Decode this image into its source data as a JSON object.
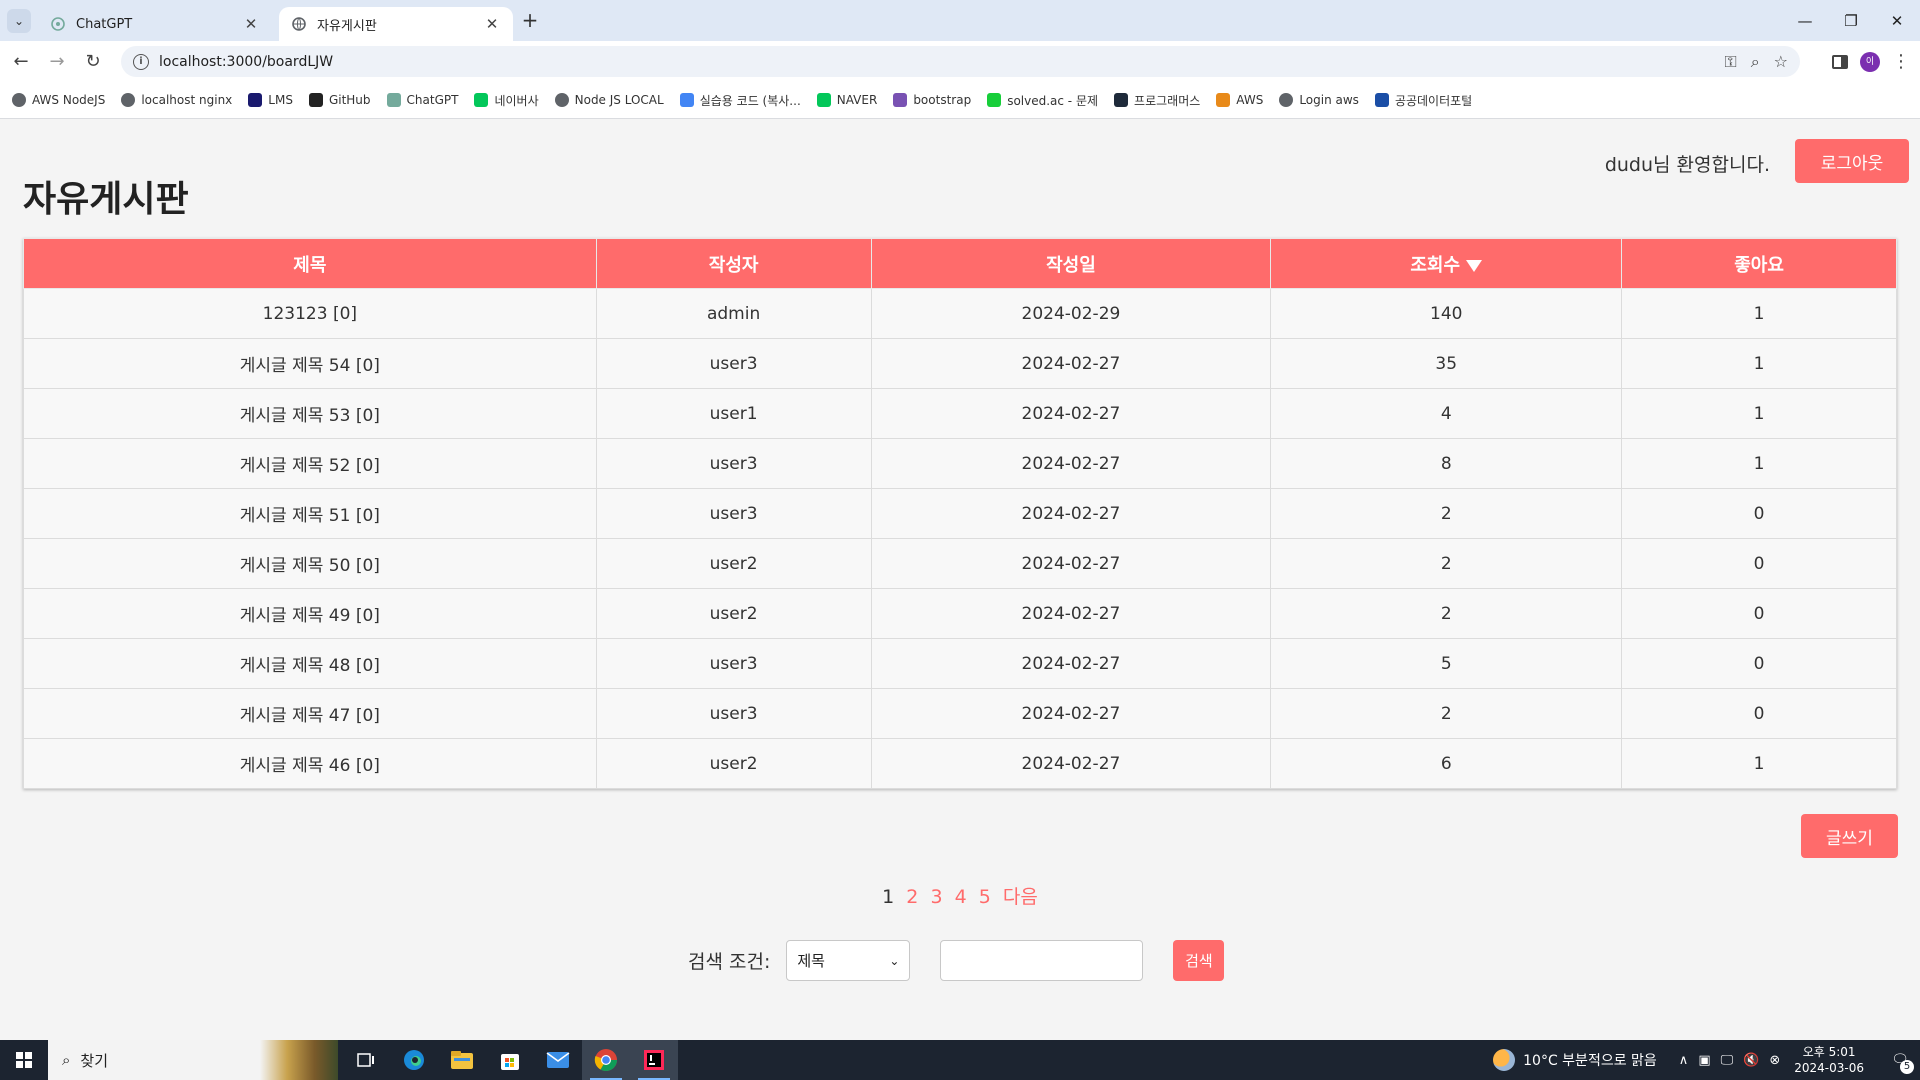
{
  "browser": {
    "tabs": [
      {
        "title": "ChatGPT",
        "icon": "chatgpt-icon"
      },
      {
        "title": "자유게시판",
        "icon": "globe-icon"
      }
    ],
    "url": "localhost:3000/boardLJW",
    "bookmarks": [
      {
        "label": "AWS NodeJS",
        "icon": "globe-icon",
        "color": "#5f6368"
      },
      {
        "label": "localhost nginx",
        "icon": "globe-icon",
        "color": "#5f6368"
      },
      {
        "label": "LMS",
        "icon": "lms-icon",
        "color": "#1a1a6e"
      },
      {
        "label": "GitHub",
        "icon": "github-icon",
        "color": "#222222"
      },
      {
        "label": "ChatGPT",
        "icon": "chatgpt-icon",
        "color": "#74aa9c"
      },
      {
        "label": "네이버사",
        "icon": "naver-icon",
        "color": "#03c75a"
      },
      {
        "label": "Node JS LOCAL",
        "icon": "globe-icon",
        "color": "#5f6368"
      },
      {
        "label": "실습용 코드 (복사...",
        "icon": "docs-icon",
        "color": "#4285f4"
      },
      {
        "label": "NAVER",
        "icon": "naver-icon",
        "color": "#03c75a"
      },
      {
        "label": "bootstrap",
        "icon": "bootstrap-icon",
        "color": "#7952b3"
      },
      {
        "label": "solved.ac - 문제",
        "icon": "solvedac-icon",
        "color": "#17ce3a"
      },
      {
        "label": "프로그래머스",
        "icon": "programmers-icon",
        "color": "#1e2a3a"
      },
      {
        "label": "AWS",
        "icon": "aws-icon",
        "color": "#e88a1a"
      },
      {
        "label": "Login aws",
        "icon": "globe-icon",
        "color": "#5f6368"
      },
      {
        "label": "공공데이터포털",
        "icon": "datagokr-icon",
        "color": "#1b4ea6"
      }
    ]
  },
  "header": {
    "welcome": "dudu님 환영합니다.",
    "logout_label": "로그아웃",
    "title": "자유게시판"
  },
  "table": {
    "columns": [
      "제목",
      "작성자",
      "작성일",
      "조회수",
      "좋아요"
    ],
    "rows": [
      [
        "123123 [0]",
        "admin",
        "2024-02-29",
        "140",
        "1"
      ],
      [
        "게시글 제목 54 [0]",
        "user3",
        "2024-02-27",
        "35",
        "1"
      ],
      [
        "게시글 제목 53 [0]",
        "user1",
        "2024-02-27",
        "4",
        "1"
      ],
      [
        "게시글 제목 52 [0]",
        "user3",
        "2024-02-27",
        "8",
        "1"
      ],
      [
        "게시글 제목 51 [0]",
        "user3",
        "2024-02-27",
        "2",
        "0"
      ],
      [
        "게시글 제목 50 [0]",
        "user2",
        "2024-02-27",
        "2",
        "0"
      ],
      [
        "게시글 제목 49 [0]",
        "user2",
        "2024-02-27",
        "2",
        "0"
      ],
      [
        "게시글 제목 48 [0]",
        "user3",
        "2024-02-27",
        "5",
        "0"
      ],
      [
        "게시글 제목 47 [0]",
        "user3",
        "2024-02-27",
        "2",
        "0"
      ],
      [
        "게시글 제목 46 [0]",
        "user2",
        "2024-02-27",
        "6",
        "1"
      ]
    ]
  },
  "write_label": "글쓰기",
  "pagination": {
    "current": "1",
    "pages": [
      "2",
      "3",
      "4",
      "5"
    ],
    "next_label": "다음"
  },
  "search": {
    "label": "검색 조건:",
    "selected": "제목",
    "query": "",
    "button_label": "검색"
  },
  "taskbar": {
    "search_placeholder": "찾기",
    "weather": "10°C 부분적으로 맑음",
    "time": "오후 5:01",
    "date": "2024-03-06",
    "notification_count": "5"
  },
  "colors": {
    "accent": "#ff6b6b",
    "taskbar": "#1c2430"
  }
}
